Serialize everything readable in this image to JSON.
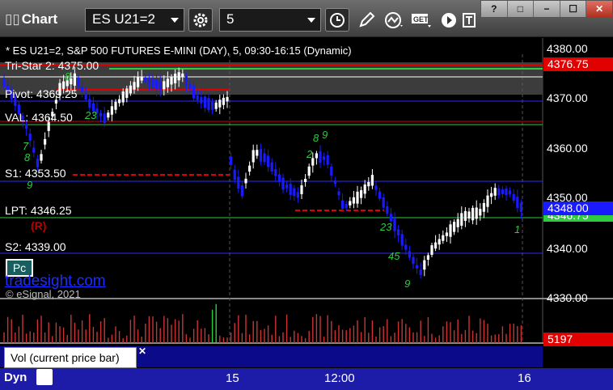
{
  "toolbar": {
    "title": "Chart",
    "symbol": "ES U21=2",
    "interval": "5",
    "window_controls": [
      "?",
      "□",
      "−",
      "☐",
      "✕"
    ],
    "icons": [
      "settings-icon",
      "clock-icon",
      "pencil-icon",
      "study-icon",
      "get-icon",
      "play-icon",
      "text-icon"
    ]
  },
  "chart": {
    "title": "* ES U21=2, S&P 500 FUTURES E-MINI (DAY), 5, 09:30-16:15 (Dynamic)",
    "levels": [
      {
        "label": "Tri-Star 2: 4375.00"
      },
      {
        "label": "Pivot: 4369.25"
      },
      {
        "label": "VAL: 4364.50"
      },
      {
        "label": "S1: 4353.50"
      },
      {
        "label": "LPT: 4346.25"
      },
      {
        "label": "S2: 4339.00"
      }
    ],
    "r_marker": "(R)",
    "price_ticks": [
      "4380.00",
      "4370.00",
      "4360.00",
      "4350.00",
      "4340.00",
      "4330.00"
    ],
    "price_tags": {
      "top": "4376.75",
      "current": "4348.00",
      "second": "4346.75",
      "volume": "5197"
    },
    "pc_button": "Pc",
    "brand": "tradesight.com",
    "copyright": "© eSignal, 2021",
    "volume_label": "Vol (current price bar)",
    "time_ticks": [
      "15",
      "12:00",
      "16"
    ],
    "footer_label": "Dyn",
    "colors": {
      "up_bar": "#ffffff",
      "down_bar": "#1a1aff",
      "resistance": "#e00000",
      "support": "#2ecc40",
      "pivot_line": "#2b2bff",
      "volume": "#cc3333",
      "accent": "#1c2cff"
    }
  }
}
